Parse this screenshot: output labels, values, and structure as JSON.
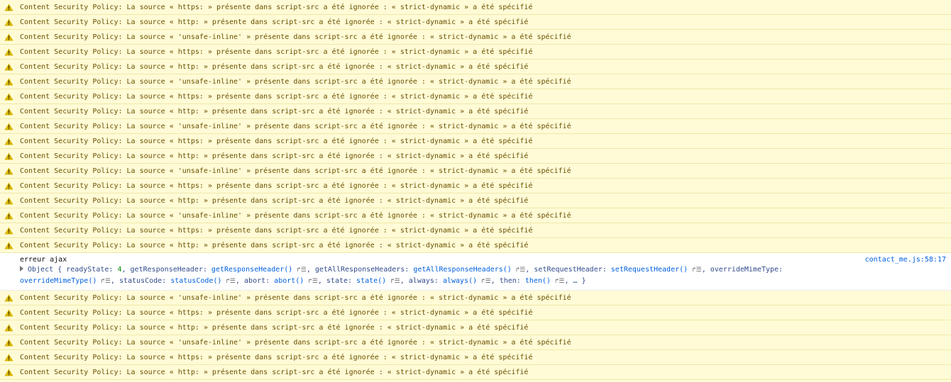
{
  "messages_top": [
    "Content Security Policy: La source « https: » présente dans script-src a été ignorée : « strict-dynamic » a été spécifié",
    "Content Security Policy: La source « http: » présente dans script-src a été ignorée : « strict-dynamic » a été spécifié",
    "Content Security Policy: La source « 'unsafe-inline' » présente dans script-src a été ignorée : « strict-dynamic » a été spécifié",
    "Content Security Policy: La source « https: » présente dans script-src a été ignorée : « strict-dynamic » a été spécifié",
    "Content Security Policy: La source « http: » présente dans script-src a été ignorée : « strict-dynamic » a été spécifié",
    "Content Security Policy: La source « 'unsafe-inline' » présente dans script-src a été ignorée : « strict-dynamic » a été spécifié",
    "Content Security Policy: La source « https: » présente dans script-src a été ignorée : « strict-dynamic » a été spécifié",
    "Content Security Policy: La source « http: » présente dans script-src a été ignorée : « strict-dynamic » a été spécifié",
    "Content Security Policy: La source « 'unsafe-inline' » présente dans script-src a été ignorée : « strict-dynamic » a été spécifié",
    "Content Security Policy: La source « https: » présente dans script-src a été ignorée : « strict-dynamic » a été spécifié",
    "Content Security Policy: La source « http: » présente dans script-src a été ignorée : « strict-dynamic » a été spécifié",
    "Content Security Policy: La source « 'unsafe-inline' » présente dans script-src a été ignorée : « strict-dynamic » a été spécifié",
    "Content Security Policy: La source « https: » présente dans script-src a été ignorée : « strict-dynamic » a été spécifié",
    "Content Security Policy: La source « http: » présente dans script-src a été ignorée : « strict-dynamic » a été spécifié",
    "Content Security Policy: La source « 'unsafe-inline' » présente dans script-src a été ignorée : « strict-dynamic » a été spécifié",
    "Content Security Policy: La source « https: » présente dans script-src a été ignorée : « strict-dynamic » a été spécifié",
    "Content Security Policy: La source « http: » présente dans script-src a été ignorée : « strict-dynamic » a été spécifié"
  ],
  "log": {
    "label": "erreur ajax",
    "source": "contact_me.js:58:17",
    "object_prefix": "Object { readyState: ",
    "ready_state": "4",
    "parts_line2": [
      {
        "key": ", getResponseHeader: ",
        "fn": "getResponseHeader()"
      },
      {
        "key": ", getAllResponseHeaders: ",
        "fn": "getAllResponseHeaders()"
      },
      {
        "key": ", setRequestHeader: ",
        "fn": "setRequestHeader()"
      },
      {
        "key": ", overrideMimeType:",
        "fn": ""
      }
    ],
    "parts_line3": [
      {
        "key": "",
        "fn": "overrideMimeType()"
      },
      {
        "key": ", statusCode: ",
        "fn": "statusCode()"
      },
      {
        "key": ", abort: ",
        "fn": "abort()"
      },
      {
        "key": ", state: ",
        "fn": "state()"
      },
      {
        "key": ", always: ",
        "fn": "always()"
      },
      {
        "key": ", then: ",
        "fn": "then()"
      }
    ],
    "tail": ", … }",
    "goto_glyph": "↱☰"
  },
  "messages_bottom": [
    "Content Security Policy: La source « 'unsafe-inline' » présente dans script-src a été ignorée : « strict-dynamic » a été spécifié",
    "Content Security Policy: La source « https: » présente dans script-src a été ignorée : « strict-dynamic » a été spécifié",
    "Content Security Policy: La source « http: » présente dans script-src a été ignorée : « strict-dynamic » a été spécifié",
    "Content Security Policy: La source « 'unsafe-inline' » présente dans script-src a été ignorée : « strict-dynamic » a été spécifié",
    "Content Security Policy: La source « https: » présente dans script-src a été ignorée : « strict-dynamic » a été spécifié",
    "Content Security Policy: La source « http: » présente dans script-src a été ignorée : « strict-dynamic » a été spécifié"
  ],
  "colors": {
    "warning_bg": "#fffbd6",
    "warning_icon": "#d7b600",
    "link": "#0060df"
  },
  "icons": {
    "warning": "warning-triangle-icon",
    "expand": "expand-triangle-icon",
    "goto": "jump-to-definition-icon"
  }
}
